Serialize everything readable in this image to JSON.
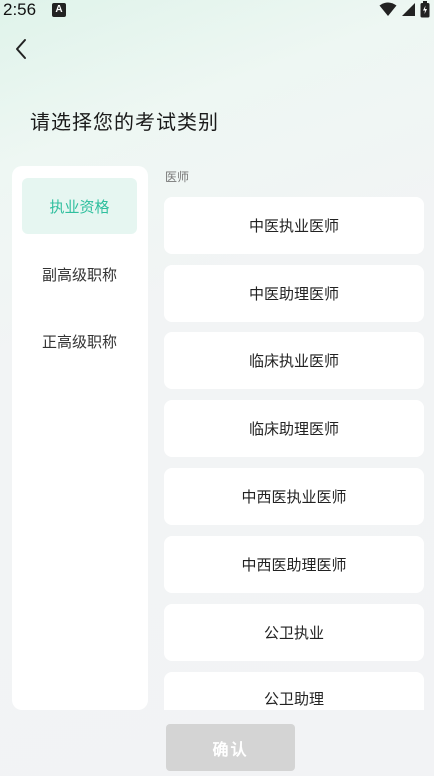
{
  "status_bar": {
    "time": "2:56",
    "notification_icon_letter": "A",
    "icons": [
      "wifi-icon",
      "signal-icon",
      "battery-icon"
    ]
  },
  "header": {
    "back_icon": "chevron-left-icon",
    "title": "请选择您的考试类别"
  },
  "sidebar": {
    "items": [
      {
        "label": "执业资格",
        "active": true
      },
      {
        "label": "副高级职称",
        "active": false
      },
      {
        "label": "正高级职称",
        "active": false
      }
    ]
  },
  "main": {
    "section_label": "医师",
    "options": [
      {
        "label": "中医执业医师"
      },
      {
        "label": "中医助理医师"
      },
      {
        "label": "临床执业医师"
      },
      {
        "label": "临床助理医师"
      },
      {
        "label": "中西医执业医师"
      },
      {
        "label": "中西医助理医师"
      },
      {
        "label": "公卫执业"
      },
      {
        "label": "公卫助理"
      }
    ]
  },
  "footer": {
    "confirm_label": "确认"
  },
  "colors": {
    "accent": "#2fbf9e",
    "active_bg": "#e6f6f1",
    "disabled_button": "#d4d4d4"
  }
}
